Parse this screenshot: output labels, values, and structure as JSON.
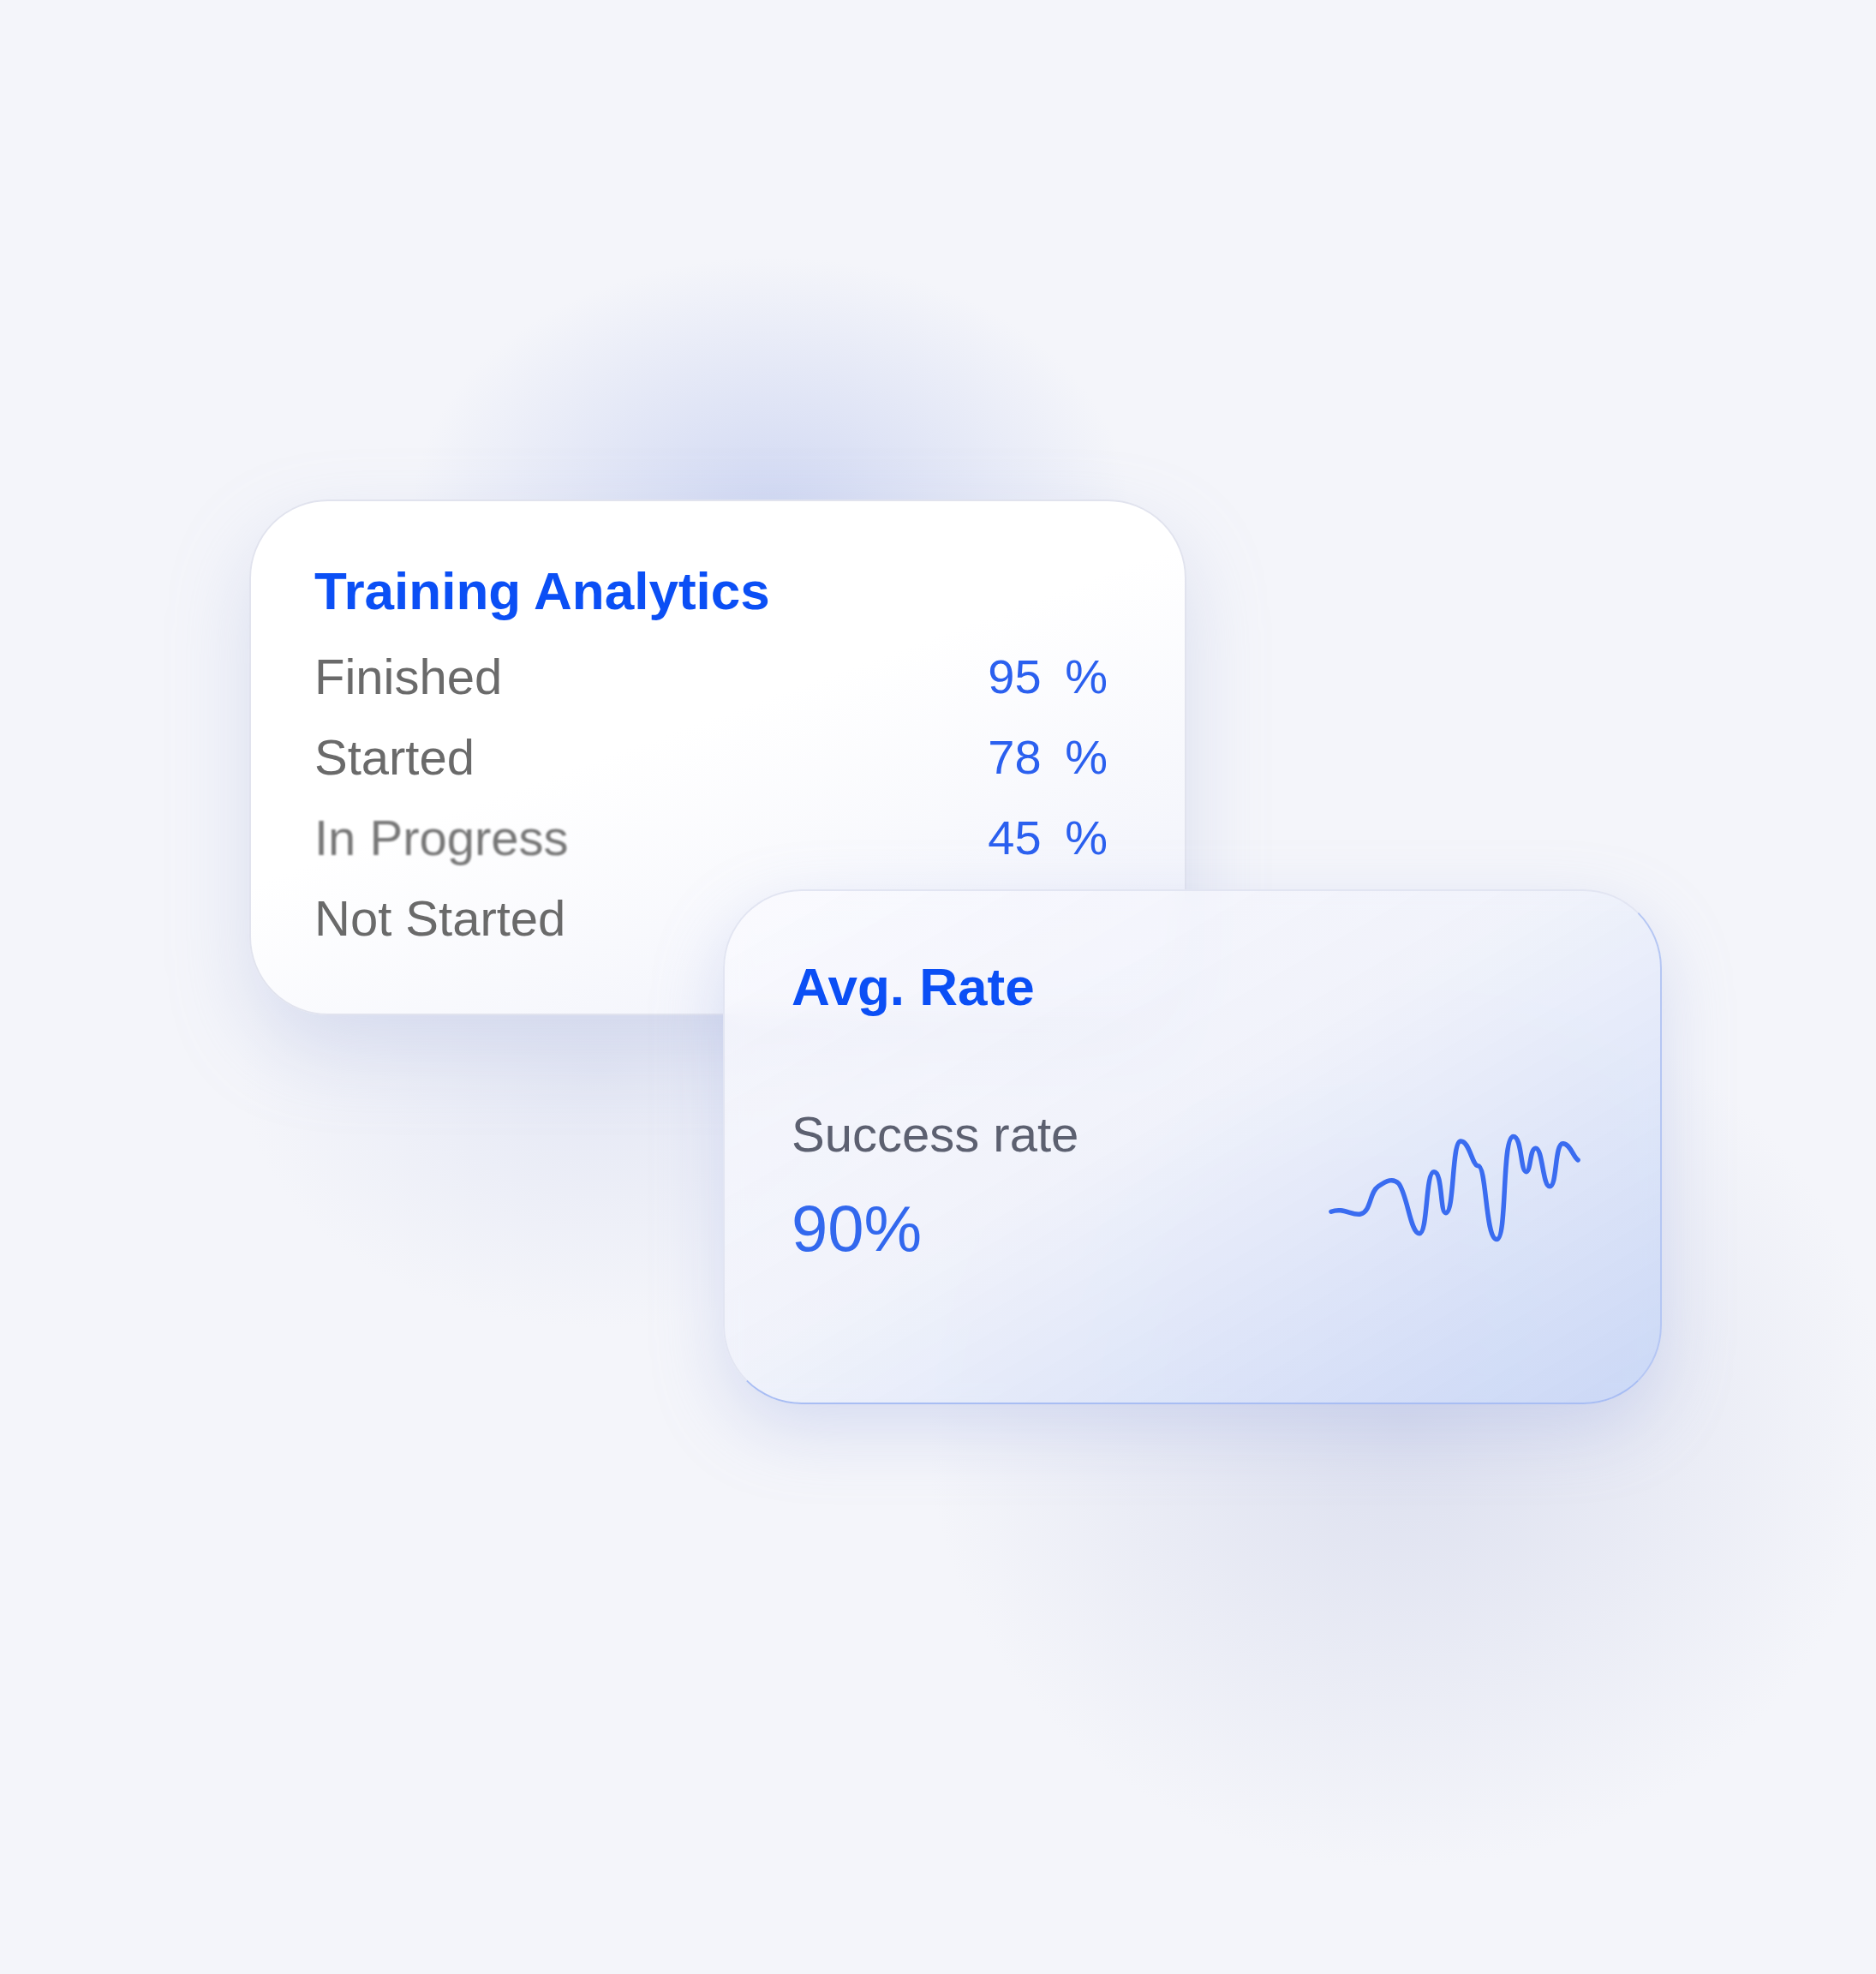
{
  "analytics_card": {
    "title": "Training Analytics",
    "rows": [
      {
        "label": "Finished",
        "value": "95 %"
      },
      {
        "label": "Started",
        "value": "78 %"
      },
      {
        "label": "In Progress",
        "value": "45 %"
      },
      {
        "label": "Not Started"
      }
    ]
  },
  "rate_card": {
    "title": "Avg. Rate",
    "metric_label": "Success rate",
    "metric_value": "90%"
  }
}
